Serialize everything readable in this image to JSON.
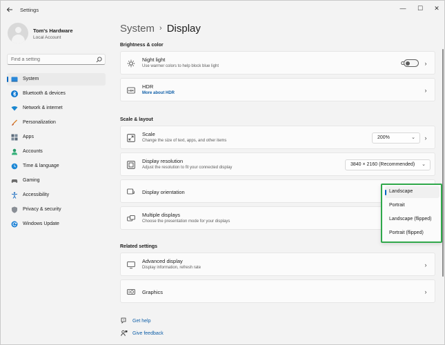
{
  "window": {
    "title": "Settings",
    "back_icon": "back-arrow-icon",
    "minimize_glyph": "—",
    "maximize_glyph": "☐",
    "close_glyph": "✕"
  },
  "user": {
    "name": "Tom's Hardware",
    "account_type": "Local Account"
  },
  "search": {
    "placeholder": "Find a setting"
  },
  "sidebar": {
    "items": [
      {
        "label": "System",
        "icon": "system-icon",
        "active": true
      },
      {
        "label": "Bluetooth & devices",
        "icon": "bluetooth-icon"
      },
      {
        "label": "Network & internet",
        "icon": "network-icon"
      },
      {
        "label": "Personalization",
        "icon": "brush-icon"
      },
      {
        "label": "Apps",
        "icon": "apps-icon"
      },
      {
        "label": "Accounts",
        "icon": "accounts-icon"
      },
      {
        "label": "Time & language",
        "icon": "globe-clock-icon"
      },
      {
        "label": "Gaming",
        "icon": "gamepad-icon"
      },
      {
        "label": "Accessibility",
        "icon": "accessibility-icon"
      },
      {
        "label": "Privacy & security",
        "icon": "shield-icon"
      },
      {
        "label": "Windows Update",
        "icon": "update-icon"
      }
    ]
  },
  "breadcrumb": {
    "parent": "System",
    "separator": "›",
    "current": "Display"
  },
  "sections": {
    "brightness": "Brightness & color",
    "scale_layout": "Scale & layout",
    "related": "Related settings"
  },
  "night_light": {
    "title": "Night light",
    "desc": "Use warmer colors to help block blue light",
    "state_label": "Off"
  },
  "hdr": {
    "title": "HDR",
    "link": "More about HDR"
  },
  "scale": {
    "title": "Scale",
    "desc": "Change the size of text, apps, and other items",
    "value": "200%"
  },
  "resolution": {
    "title": "Display resolution",
    "desc": "Adjust the resolution to fit your connected display",
    "value": "3840 × 2160 (Recommended)"
  },
  "orientation": {
    "title": "Display orientation",
    "options": [
      "Landscape",
      "Portrait",
      "Landscape (flipped)",
      "Portrait (flipped)"
    ],
    "selected": "Landscape"
  },
  "multiple_displays": {
    "title": "Multiple displays",
    "desc": "Choose the presentation mode for your displays"
  },
  "advanced_display": {
    "title": "Advanced display",
    "desc": "Display information, refresh rate"
  },
  "graphics": {
    "title": "Graphics"
  },
  "footer": {
    "help": "Get help",
    "feedback": "Give feedback"
  },
  "colors": {
    "accent": "#0067c0",
    "highlight_border": "#2fa84a",
    "link": "#0f5fa8"
  }
}
